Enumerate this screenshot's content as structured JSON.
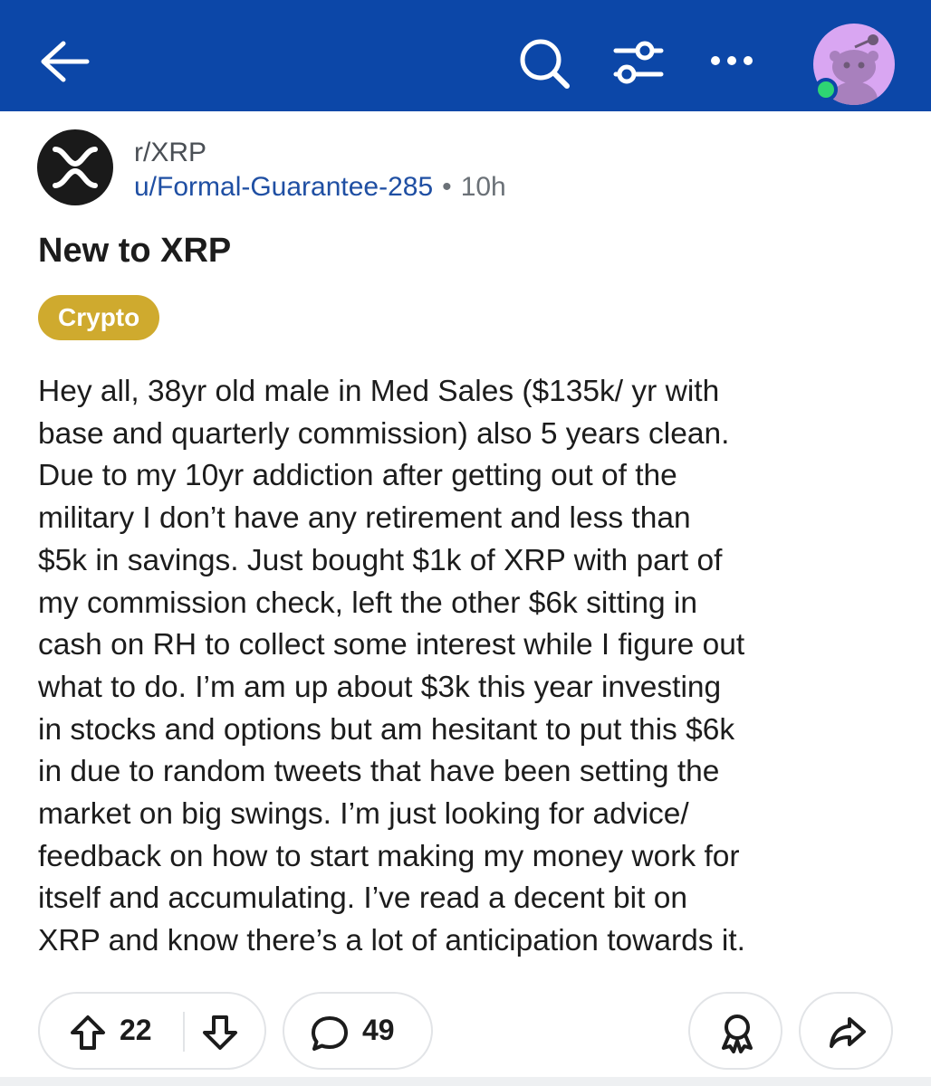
{
  "header": {
    "back_icon": "arrow-left-icon",
    "search_icon": "search-icon",
    "filter_icon": "filter-sliders-icon",
    "more_icon": "more-horizontal-icon",
    "avatar_icon": "user-avatar",
    "online_status": "online",
    "colors": {
      "bar": "#0c47a8",
      "avatar_bg": "#d9a6f2",
      "online": "#2ed573"
    }
  },
  "post": {
    "subreddit": "r/XRP",
    "subreddit_icon": "xrp-logo-icon",
    "author": "u/Formal-Guarantee-285",
    "separator": "•",
    "time": "10h",
    "title": "New to XRP",
    "flair": "Crypto",
    "flair_color": "#cfaa2e",
    "body": "Hey all, 38yr old male in Med Sales ($135k/ yr with\nbase and quarterly commission) also 5 years clean.\nDue to my 10yr addiction after getting out of the\nmilitary I don’t have any retirement and less than\n$5k in savings. Just bought $1k of XRP with part of\nmy commission check, left the other $6k sitting in\ncash on RH to collect some interest while I figure out\nwhat to do. I’m am up about $3k this year investing\nin stocks and options but am hesitant to put this $6k\nin due to random tweets that have been setting the\nmarket on big swings. I’m just looking for advice/\nfeedback on how to start making my money work for\nitself and accumulating. I’ve read a decent bit on\nXRP and know there’s a lot of anticipation towards it."
  },
  "actions": {
    "upvote_icon": "upvote-arrow-icon",
    "upvotes": "22",
    "downvote_icon": "downvote-arrow-icon",
    "comment_icon": "comment-bubble-icon",
    "comments": "49",
    "award_icon": "award-icon",
    "share_icon": "share-arrow-icon"
  }
}
